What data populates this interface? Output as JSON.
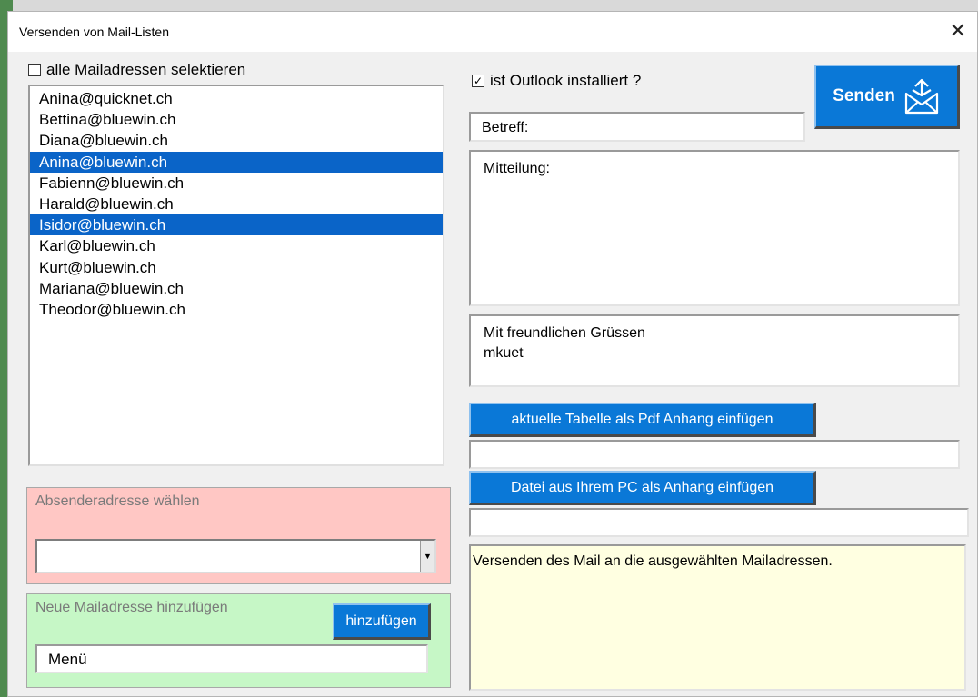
{
  "window": {
    "title": "Versenden von Mail-Listen",
    "close_label": "✕"
  },
  "select_all": {
    "label": "alle Mailadressen selektieren",
    "checked": false
  },
  "mail_list": [
    {
      "address": "Anina@quicknet.ch",
      "selected": false
    },
    {
      "address": "Bettina@bluewin.ch",
      "selected": false
    },
    {
      "address": "Diana@bluewin.ch",
      "selected": false
    },
    {
      "address": "Anina@bluewin.ch",
      "selected": true
    },
    {
      "address": "Fabienn@bluewin.ch",
      "selected": false
    },
    {
      "address": "Harald@bluewin.ch",
      "selected": false
    },
    {
      "address": "Isidor@bluewin.ch",
      "selected": true
    },
    {
      "address": "Karl@bluewin.ch",
      "selected": false
    },
    {
      "address": "Kurt@bluewin.ch",
      "selected": false
    },
    {
      "address": "Mariana@bluewin.ch",
      "selected": false
    },
    {
      "address": "Theodor@bluewin.ch",
      "selected": false
    }
  ],
  "sender": {
    "label": "Absenderadresse wählen",
    "value": ""
  },
  "new_address": {
    "label": "Neue Mailadresse hinzufügen",
    "button_label": "hinzufügen",
    "value": "Menü"
  },
  "outlook": {
    "label": "ist Outlook installiert ?",
    "checked": true,
    "check_mark": "✓"
  },
  "send_button": {
    "label": "Senden",
    "icon": "mail-send-icon"
  },
  "subject": {
    "value": "Betreff:"
  },
  "message": {
    "value": "Mitteilung:"
  },
  "signature": {
    "line1": "Mit freundlichen Grüssen",
    "line2": "mkuet"
  },
  "pdf_attachment": {
    "button_label": "aktuelle Tabelle als Pdf Anhang einfügen",
    "value": ""
  },
  "file_attachment": {
    "button_label": "Datei aus Ihrem PC als Anhang einfügen",
    "value": ""
  },
  "status": {
    "text": "Versenden des Mail an die ausgewählten Mailadressen."
  },
  "colors": {
    "accent_blue": "#0a78d7",
    "selection_blue": "#0a64c8",
    "sender_panel": "#ffc7c4",
    "new_address_panel": "#c6f7c6",
    "status_panel": "#ffffe1"
  }
}
